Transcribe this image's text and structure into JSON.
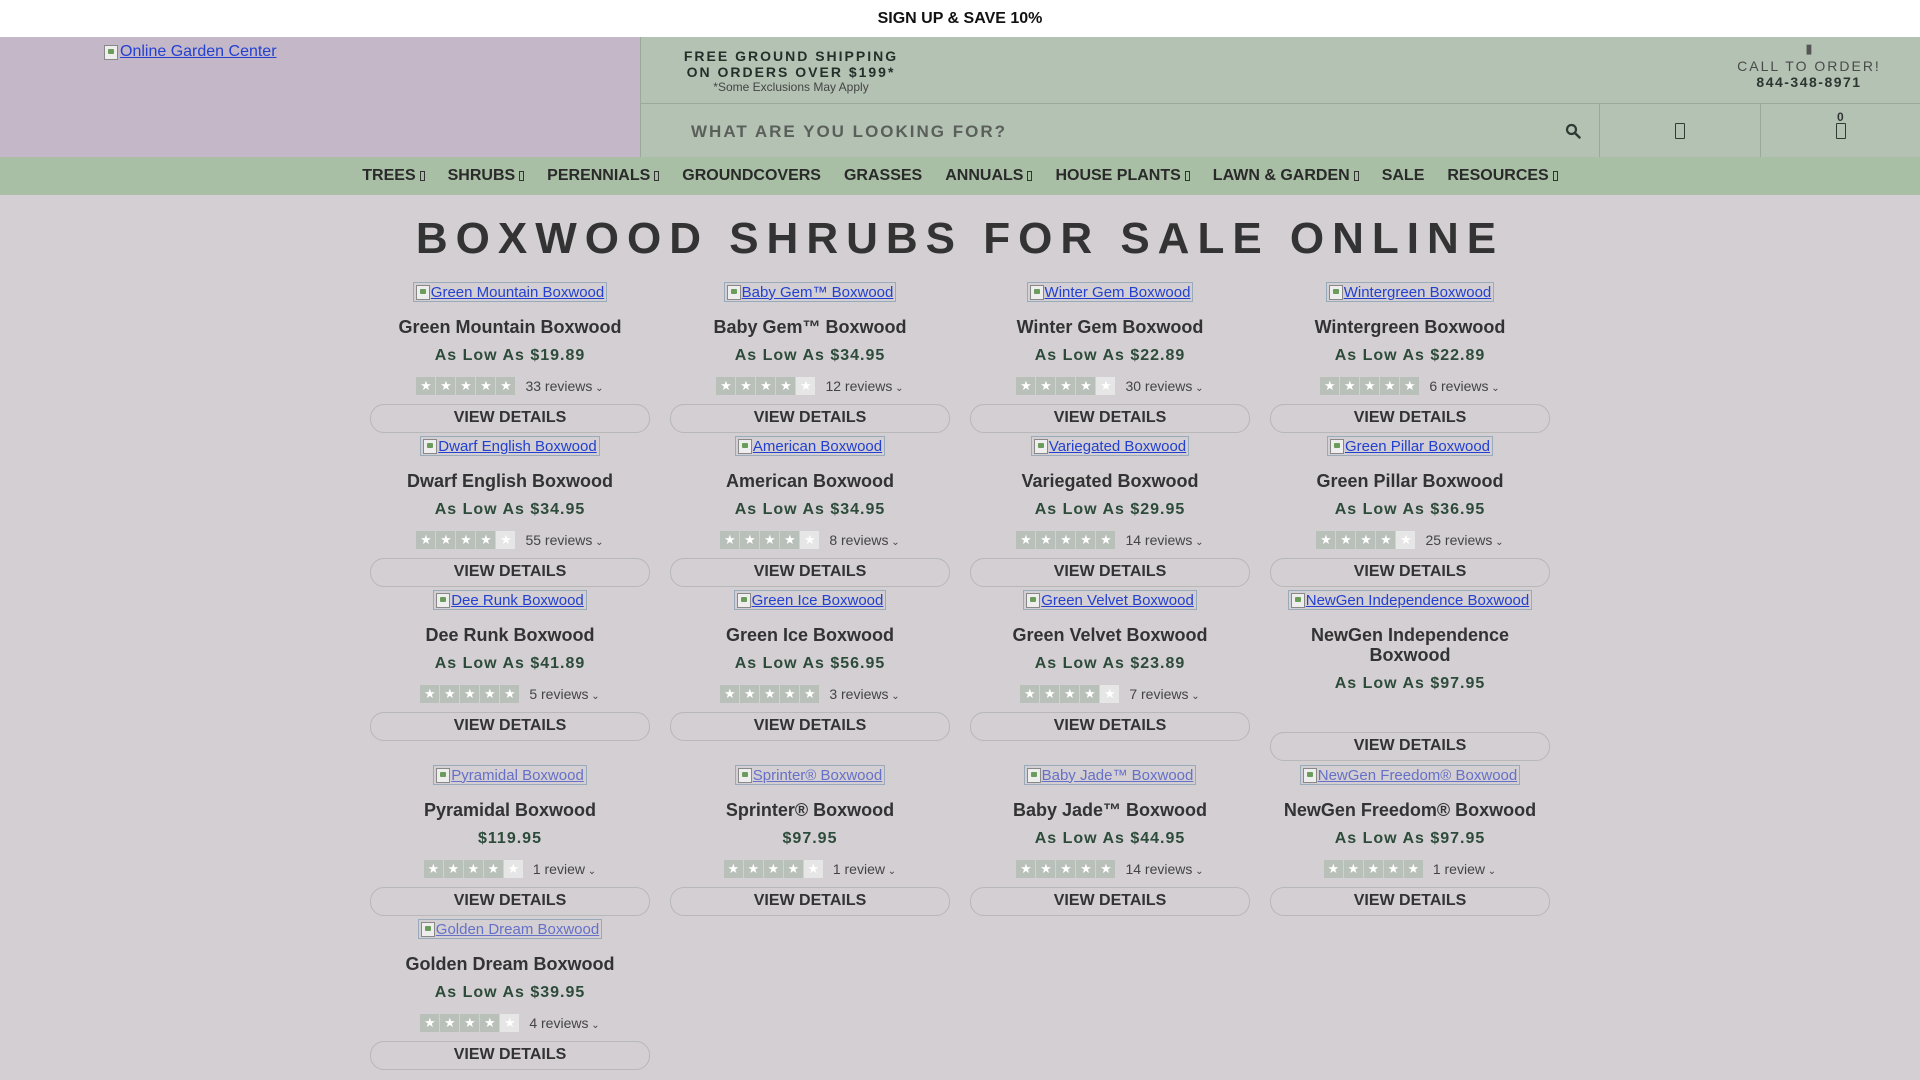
{
  "promo": {
    "text": "SIGN UP & SAVE 10%"
  },
  "logo": {
    "alt": "Online Garden Center"
  },
  "shipping": {
    "line1": "FREE GROUND SHIPPING",
    "line2": "ON ORDERS OVER $199*",
    "note": "*Some Exclusions May Apply"
  },
  "call": {
    "label": "CALL TO ORDER!",
    "number": "844-348-8971"
  },
  "search": {
    "placeholder": "WHAT ARE YOU LOOKING FOR?"
  },
  "cart": {
    "count": "0"
  },
  "nav": [
    {
      "label": "TREES",
      "dropdown": true
    },
    {
      "label": "SHRUBS",
      "dropdown": true
    },
    {
      "label": "PERENNIALS",
      "dropdown": true
    },
    {
      "label": "GROUNDCOVERS",
      "dropdown": false
    },
    {
      "label": "GRASSES",
      "dropdown": false
    },
    {
      "label": "ANNUALS",
      "dropdown": true
    },
    {
      "label": "HOUSE PLANTS",
      "dropdown": true
    },
    {
      "label": "LAWN & GARDEN",
      "dropdown": true
    },
    {
      "label": "SALE",
      "dropdown": false
    },
    {
      "label": "RESOURCES",
      "dropdown": true
    }
  ],
  "page_title": "BOXWOOD SHRUBS FOR SALE ONLINE",
  "view_label": "VIEW DETAILS",
  "products": [
    {
      "alt": "Green Mountain Boxwood",
      "name": "Green Mountain Boxwood",
      "price": "As Low As $19.89",
      "stars": 5,
      "reviews": "33 reviews"
    },
    {
      "alt": "Baby Gem™ Boxwood",
      "name": "Baby Gem™ Boxwood",
      "price": "As Low As $34.95",
      "stars": 4,
      "reviews": "12 reviews"
    },
    {
      "alt": "Winter Gem Boxwood",
      "name": "Winter Gem Boxwood",
      "price": "As Low As $22.89",
      "stars": 4,
      "reviews": "30 reviews"
    },
    {
      "alt": "Wintergreen Boxwood",
      "name": "Wintergreen Boxwood",
      "price": "As Low As $22.89",
      "stars": 5,
      "reviews": "6 reviews"
    },
    {
      "alt": "Dwarf English Boxwood",
      "name": "Dwarf English Boxwood",
      "price": "As Low As $34.95",
      "stars": 4,
      "reviews": "55 reviews"
    },
    {
      "alt": "American Boxwood",
      "name": "American Boxwood",
      "price": "As Low As $34.95",
      "stars": 4,
      "reviews": "8 reviews"
    },
    {
      "alt": "Variegated Boxwood",
      "name": "Variegated Boxwood",
      "price": "As Low As $29.95",
      "stars": 5,
      "reviews": "14 reviews"
    },
    {
      "alt": "Green Pillar Boxwood",
      "name": "Green Pillar Boxwood",
      "price": "As Low As $36.95",
      "stars": 4,
      "reviews": "25 reviews"
    },
    {
      "alt": "Dee Runk Boxwood",
      "name": "Dee Runk Boxwood",
      "price": "As Low As $41.89",
      "stars": 5,
      "reviews": "5 reviews"
    },
    {
      "alt": "Green Ice Boxwood",
      "name": "Green Ice Boxwood",
      "price": "As Low As $56.95",
      "stars": 5,
      "reviews": "3 reviews"
    },
    {
      "alt": "Green Velvet Boxwood",
      "name": "Green Velvet Boxwood",
      "price": "As Low As $23.89",
      "stars": 4,
      "reviews": "7 reviews"
    },
    {
      "alt": "NewGen Independence Boxwood",
      "name": "NewGen Independence Boxwood",
      "price": "As Low As $97.95",
      "stars": null,
      "reviews": ""
    },
    {
      "alt": "Pyramidal Boxwood",
      "name": "Pyramidal Boxwood",
      "price": "$119.95",
      "stars": 4,
      "reviews": "1 review"
    },
    {
      "alt": "Sprinter® Boxwood",
      "name": "Sprinter® Boxwood",
      "price": "$97.95",
      "stars": 4,
      "reviews": "1 review"
    },
    {
      "alt": "Baby Jade™ Boxwood",
      "name": "Baby Jade™ Boxwood",
      "price": "As Low As $44.95",
      "stars": 5,
      "reviews": "14 reviews"
    },
    {
      "alt": "NewGen Freedom® Boxwood",
      "name": "NewGen Freedom® Boxwood",
      "price": "As Low As $97.95",
      "stars": 5,
      "reviews": "1 review"
    },
    {
      "alt": "Golden Dream Boxwood",
      "name": "Golden Dream Boxwood",
      "price": "As Low As $39.95",
      "stars": 4,
      "reviews": "4 reviews"
    }
  ]
}
